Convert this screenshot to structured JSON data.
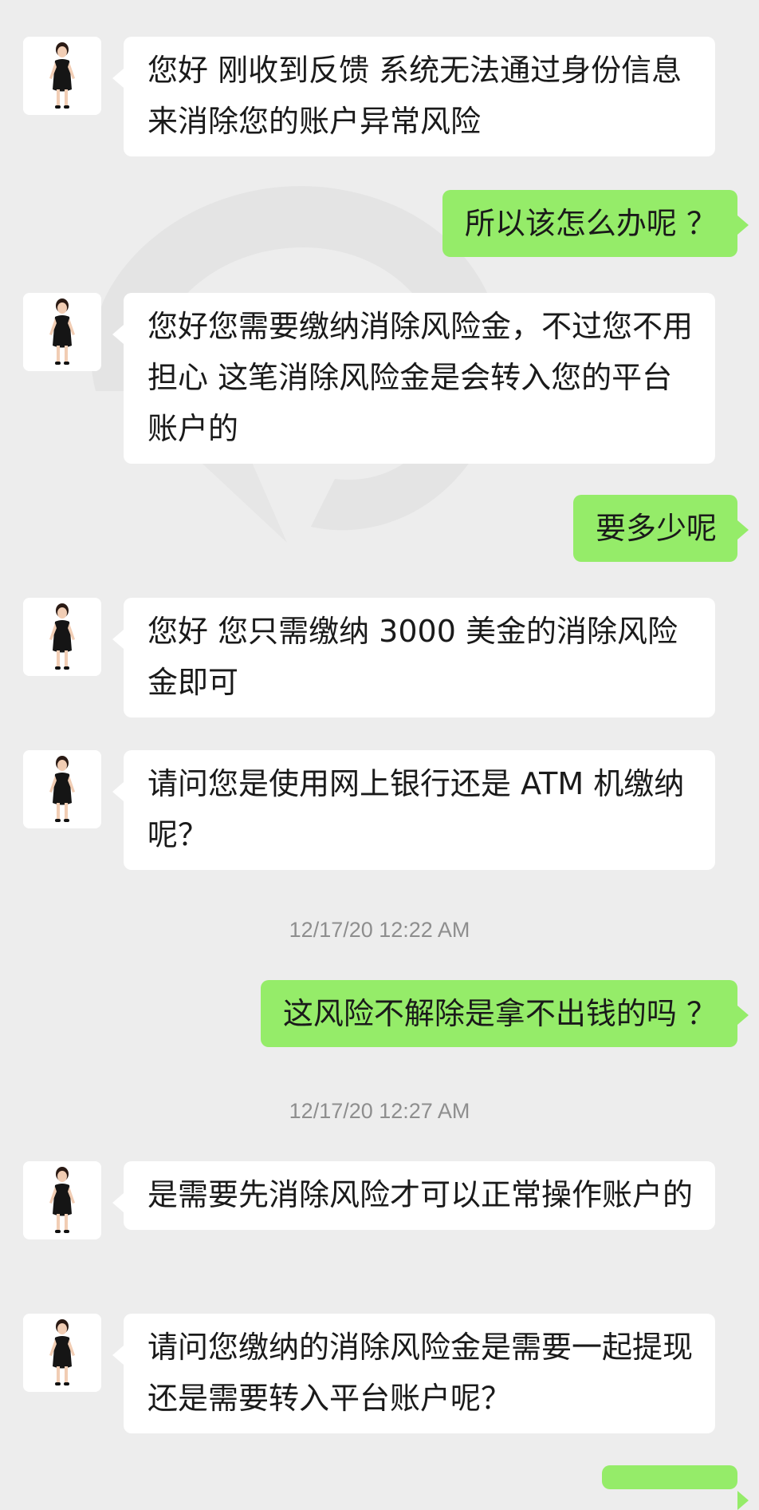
{
  "messages": [
    {
      "side": "in",
      "text": "您好 刚收到反馈 系统无法通过身份信息来消除您的账户异常风险"
    },
    {
      "side": "out",
      "text": "所以该怎么办呢 ？"
    },
    {
      "side": "in",
      "text": "您好您需要缴纳消除风险金，不过您不用担心 这笔消除风险金是会转入您的平台账户的"
    },
    {
      "side": "out",
      "text": "要多少呢"
    },
    {
      "side": "in",
      "text": "您好 您只需缴纳 3000 美金的消除风险金即可"
    },
    {
      "side": "in",
      "text": "请问您是使用网上银行还是 ATM 机缴纳呢？"
    },
    {
      "side": "out",
      "text": "这风险不解除是拿不出钱的吗 ？"
    },
    {
      "side": "in",
      "text": "是需要先消除风险才可以正常操作账户的"
    },
    {
      "side": "in",
      "text": "请问您缴纳的消除风险金是需要一起提现还是需要转入平台账户呢？"
    }
  ],
  "timestamps": [
    "12/17/20 12:22 AM",
    "12/17/20 12:27 AM"
  ],
  "colors": {
    "background": "#ededed",
    "incoming_bubble": "#ffffff",
    "outgoing_bubble": "#95ec69",
    "timestamp_text": "#8e8e8e"
  },
  "icons": {
    "avatar": "agent-avatar-icon",
    "watermark": "watermark-logo"
  }
}
